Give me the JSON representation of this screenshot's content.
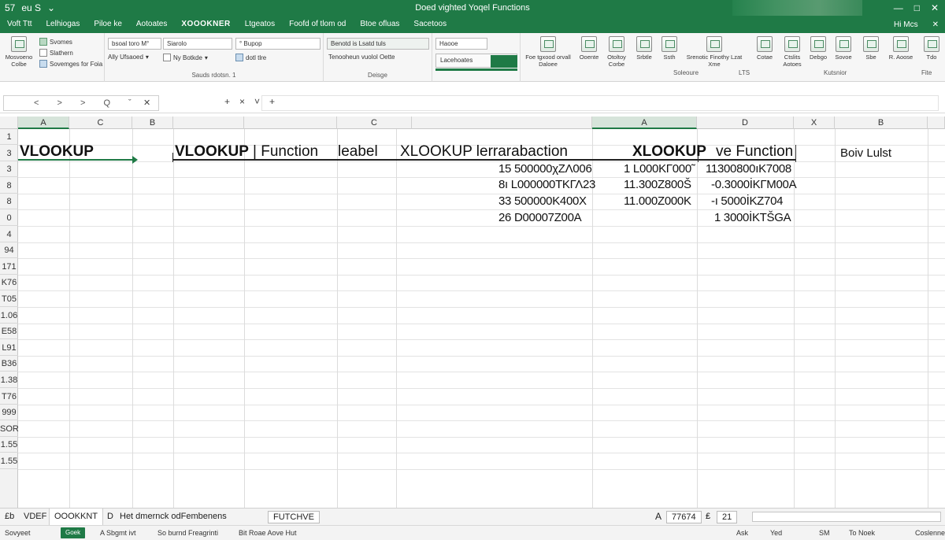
{
  "titlebar": {
    "quick_access": [
      "57",
      "eu S",
      "⌄"
    ],
    "title": "Doed vighted Yoqel Functions",
    "controls": [
      "—",
      "□",
      "✕"
    ]
  },
  "tabs": {
    "items": [
      "Voft Ttt",
      "Lelhiogas",
      "Piloe ke",
      "Aotoates",
      "XOOOKNER",
      "Ltgeatos",
      "Foofd of tlom od",
      "Btoe ofluas",
      "Sacetoos"
    ],
    "active_index": 4,
    "right": [
      "Hi Mcs",
      "✕"
    ]
  },
  "ribbon": {
    "clipboard": {
      "items": [
        "Svomes",
        "Slathern",
        "Sovemges for Foia"
      ],
      "big_label": "Mosvoeno Colbe",
      "group": "Sauds rdotsn. 1"
    },
    "font": {
      "box1": "bsoal toro M°",
      "box2": "Ally Ufsaoed",
      "box3": "Siarolo",
      "box4": "Ny Botkde",
      "box5": "° Bupop",
      "box6": "dotl tlre"
    },
    "alignment": {
      "label1": "Benotd is Lsatd tuls",
      "label2": "Tenooheun vuolol Oette",
      "group": "Deisge"
    },
    "number": {
      "dropdown": "Haooe",
      "value": "Lacehoates",
      "group": ""
    },
    "buttons": [
      {
        "label": "Foe tgxood orvall Daloee"
      },
      {
        "label": "Ooente"
      },
      {
        "label": "Otoltoy Corbe"
      },
      {
        "label": "Srbtle"
      },
      {
        "label": "Ssth"
      },
      {
        "label": "Srenotic Finothy Lzat Xme"
      },
      {
        "label": "Cotae"
      },
      {
        "label": "Ctslits Aotoes"
      },
      {
        "label": "Debgo"
      },
      {
        "label": "Sovoe"
      },
      {
        "label": "Sbe"
      },
      {
        "label": "R. Aoose"
      },
      {
        "label": "Tdo"
      }
    ],
    "group_labels": [
      "Soleoure",
      "LTS",
      "Kutsnior",
      "Fite"
    ]
  },
  "formula_bar": {
    "name_box": "< > > Q ˇ",
    "close_icon": "✕",
    "buttons": [
      "+",
      "×",
      "˅",
      "+"
    ]
  },
  "columns": [
    {
      "label": "A",
      "selected": true
    },
    {
      "label": "C",
      "selected": false
    },
    {
      "label": "B",
      "selected": false
    },
    {
      "label": "",
      "selected": false
    },
    {
      "label": "C",
      "selected": false
    },
    {
      "label": "",
      "selected": false
    },
    {
      "label": "A",
      "selected": true
    },
    {
      "label": "D",
      "selected": false
    },
    {
      "label": "X",
      "selected": false
    },
    {
      "label": "B",
      "selected": false
    }
  ],
  "rows": [
    "1",
    "3",
    "3",
    "8",
    "8",
    "0",
    "4",
    "94",
    "171",
    "K76",
    "T05",
    "1.06",
    "E58",
    "L91",
    "B36",
    "1.38",
    "T76",
    "999",
    "SOR",
    "1.55",
    "1.55"
  ],
  "cells": {
    "a1": "VLOOKUP",
    "c1_func": "VLOOKUP",
    "c1_func_rest": "| Function",
    "c1_label": "leabel",
    "e1": "XLOOKUP lerrarabaction",
    "g1": "XLOOKUP",
    "g1_rest": "ve Function",
    "k1": "Boiv Lulst",
    "numbers_f": [
      "15 500000χZΛ006",
      "8ı L000000ΤΚΓΛ23",
      "33 500000K400X",
      "26 D00007Z00A"
    ],
    "numbers_g": [
      "1 L000KΓ000˜",
      "11.300Z800Š",
      "11.000Z000K",
      ""
    ],
    "numbers_h": [
      "11300800ıΚ7008",
      "-0.3000İΚΓΜ00A",
      "-ı 5000İΚZ704",
      "1 3000İΚΤŠGA"
    ]
  },
  "sheet_tabs": {
    "items": [
      "£b",
      "VDEF",
      "OOOKKNT",
      "D",
      "Het dmernck odFembenens",
      "FUTCHVE"
    ],
    "active_index": 2,
    "right_items": [
      "A",
      "77674",
      "₤",
      "21"
    ]
  },
  "status": {
    "left": "Sovyeet",
    "button": "Goek",
    "items": [
      "A Sbgmt ivt",
      "So burnd Freagrinti",
      "Bit Roae Aove Hut"
    ],
    "right": [
      "Ask",
      "Yed",
      "SM",
      "To Noek",
      "Coslenne"
    ]
  },
  "colors": {
    "accent": "#1f7a46",
    "header_bg": "#f2f2f2",
    "selected_header": "#d6e4da"
  }
}
